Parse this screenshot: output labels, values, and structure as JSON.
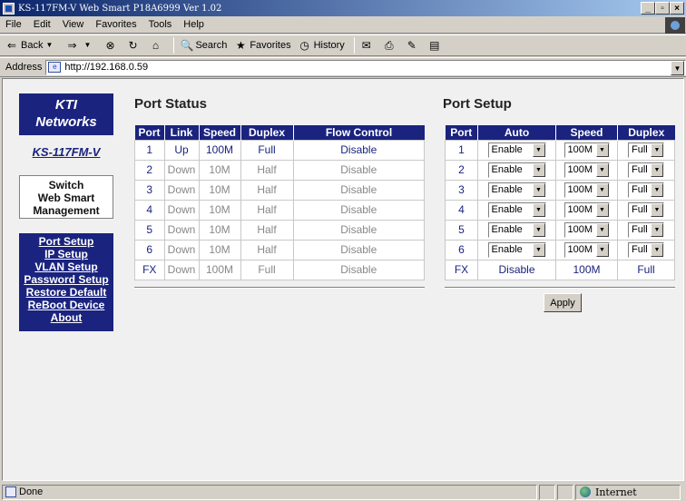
{
  "window": {
    "title": "KS-117FM-V Web Smart P18A6999 Ver 1.02"
  },
  "menu": [
    "File",
    "Edit",
    "View",
    "Favorites",
    "Tools",
    "Help"
  ],
  "toolbar": {
    "back": "Back",
    "search": "Search",
    "favorites": "Favorites",
    "history": "History"
  },
  "address": {
    "label": "Address",
    "url": "http://192.168.0.59"
  },
  "sidebar": {
    "logo_line1": "KTI",
    "logo_line2": "Networks",
    "model": "KS-117FM-V",
    "box_line1": "Switch",
    "box_line2": "Web Smart",
    "box_line3": "Management",
    "links": [
      "Port Setup",
      "IP Setup",
      "VLAN Setup",
      "Password Setup",
      "Restore Default",
      "ReBoot Device",
      "About"
    ]
  },
  "port_status": {
    "title": "Port Status",
    "headers": [
      "Port",
      "Link",
      "Speed",
      "Duplex",
      "Flow Control"
    ],
    "rows": [
      [
        "1",
        "Up",
        "100M",
        "Full",
        "Disable"
      ],
      [
        "2",
        "Down",
        "10M",
        "Half",
        "Disable"
      ],
      [
        "3",
        "Down",
        "10M",
        "Half",
        "Disable"
      ],
      [
        "4",
        "Down",
        "10M",
        "Half",
        "Disable"
      ],
      [
        "5",
        "Down",
        "10M",
        "Half",
        "Disable"
      ],
      [
        "6",
        "Down",
        "10M",
        "Half",
        "Disable"
      ],
      [
        "FX",
        "Down",
        "100M",
        "Full",
        "Disable"
      ]
    ]
  },
  "port_setup": {
    "title": "Port Setup",
    "headers": [
      "Port",
      "Auto",
      "Speed",
      "Duplex"
    ],
    "rows": [
      [
        "1",
        "Enable",
        "100M",
        "Full"
      ],
      [
        "2",
        "Enable",
        "100M",
        "Full"
      ],
      [
        "3",
        "Enable",
        "100M",
        "Full"
      ],
      [
        "4",
        "Enable",
        "100M",
        "Full"
      ],
      [
        "5",
        "Enable",
        "100M",
        "Full"
      ],
      [
        "6",
        "Enable",
        "100M",
        "Full"
      ]
    ],
    "fx_row": [
      "FX",
      "Disable",
      "100M",
      "Full"
    ],
    "apply_label": "Apply"
  },
  "status": {
    "text": "Done",
    "zone": "Internet"
  }
}
